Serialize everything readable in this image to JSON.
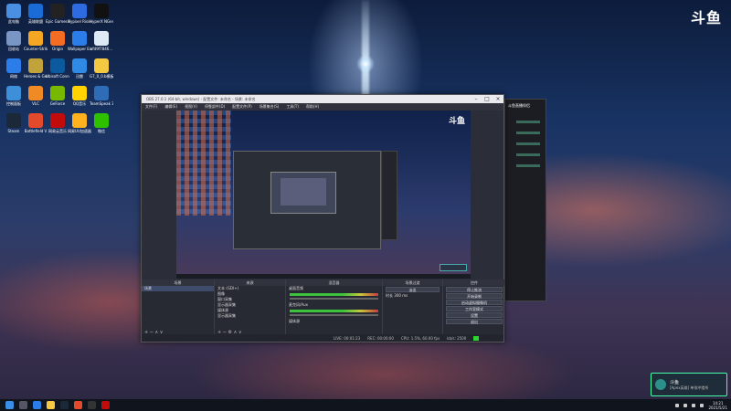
{
  "watermark": "斗鱼",
  "desktop_icons": [
    {
      "label": "此电脑",
      "color": "#4a90e2"
    },
    {
      "label": "英雄联盟",
      "color": "#1b6bd6"
    },
    {
      "label": "Epic Games Launcher",
      "color": "#222222"
    },
    {
      "label": "Hypixel Rising",
      "color": "#2e6be0"
    },
    {
      "label": "HyperX NGenuity",
      "color": "#111111"
    },
    {
      "label": "回收站",
      "color": "#7a96c4"
    },
    {
      "label": "Counter-Strike Global Off...",
      "color": "#f5a623"
    },
    {
      "label": "Origin",
      "color": "#f56c23"
    },
    {
      "label": "Wallpaper Engine",
      "color": "#2b7de9"
    },
    {
      "label": "afd9f7846...",
      "color": "#dfe8f5"
    },
    {
      "label": "网络",
      "color": "#2b7de9"
    },
    {
      "label": "Heroes & Generals",
      "color": "#c2a23a"
    },
    {
      "label": "Ubisoft Connect",
      "color": "#0c5a9e"
    },
    {
      "label": "迅雷",
      "color": "#2f8ae6"
    },
    {
      "label": "G7_0_0.b模板",
      "color": "#f5c842"
    },
    {
      "label": "控制面板",
      "color": "#3c8fd8"
    },
    {
      "label": "VLC",
      "color": "#f08a24"
    },
    {
      "label": "GeForce",
      "color": "#76b900"
    },
    {
      "label": "QQ音乐",
      "color": "#ffd200"
    },
    {
      "label": "TeamSpeak 3",
      "color": "#2e6db6"
    },
    {
      "label": "Steam",
      "color": "#1b2838"
    },
    {
      "label": "Battlefield V",
      "color": "#e34a2b"
    },
    {
      "label": "网易云音乐",
      "color": "#c20c0c"
    },
    {
      "label": "网易UU加速器",
      "color": "#ffb21e"
    },
    {
      "label": "微信",
      "color": "#2dc100"
    }
  ],
  "obs": {
    "title": "OBS 27.0.1 (64-bit, windows) - 配置文件: 未命名 - 场景: 未命名",
    "menu": [
      "文件(F)",
      "编辑(E)",
      "视图(V)",
      "停靠部件(D)",
      "配置文件(P)",
      "场景集合(S)",
      "工具(T)",
      "帮助(H)"
    ],
    "preview_logo": "斗鱼",
    "panels": {
      "scenes": {
        "header": "场景",
        "items": [
          "场景"
        ]
      },
      "sources": {
        "header": "来源",
        "items": [
          "文本 (GDI+)",
          "图像",
          "窗口采集",
          "显示器采集",
          "媒体源",
          "显示器采集"
        ]
      },
      "mixer": {
        "header": "混音器",
        "tracks": [
          "桌面音频",
          "麦克风/Aux",
          "媒体源"
        ]
      },
      "transitions": {
        "header": "场景过渡",
        "type": "淡出",
        "duration_label": "时长",
        "duration": "300 ms"
      },
      "controls": {
        "header": "控件",
        "buttons": [
          "停止推流",
          "开始录制",
          "启动虚拟摄像机",
          "工作室模式",
          "设置",
          "退出"
        ]
      }
    },
    "status": {
      "live": "LIVE: 00:01:23",
      "rec": "REC: 00:00:00",
      "cpu": "CPU: 1.5%, 60.00 fps",
      "kbps": "kb/s: 2500"
    }
  },
  "side_window": {
    "title": "斗鱼直播伴侣"
  },
  "toast": {
    "title": "斗鱼",
    "message": "[Apex英雄] 单排冲猎杀"
  },
  "clock": {
    "time": "14:21",
    "date": "2021/5/21"
  }
}
